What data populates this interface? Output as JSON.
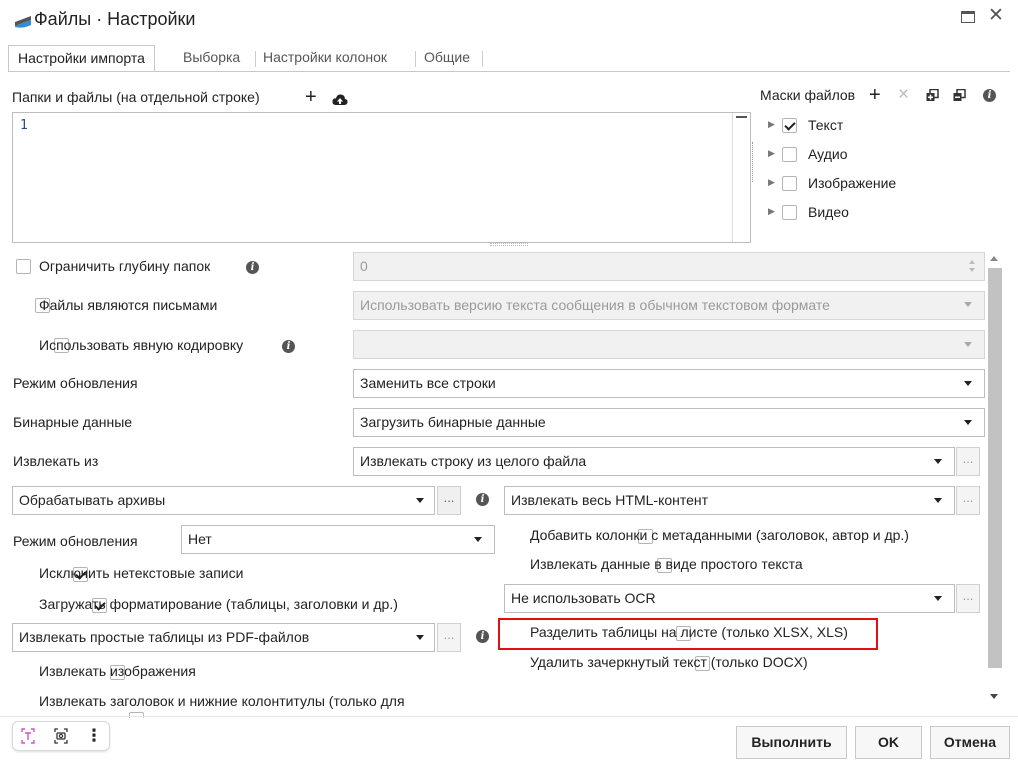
{
  "window": {
    "title": "Файлы · Настройки"
  },
  "tabs": [
    {
      "label": "Настройки импорта",
      "active": true
    },
    {
      "label": "Выборка",
      "active": false
    },
    {
      "label": "Настройки колонок",
      "active": false
    },
    {
      "label": "Общие",
      "active": false
    }
  ],
  "folders": {
    "label": "Папки и файлы (на отдельной строке)",
    "add_symbol": "+",
    "line_numbers": [
      "1"
    ]
  },
  "masks": {
    "label": "Маски файлов",
    "add_symbol": "+",
    "remove_symbol": "×",
    "items": [
      {
        "label": "Текст",
        "checked": true
      },
      {
        "label": "Аудио",
        "checked": false
      },
      {
        "label": "Изображение",
        "checked": false
      },
      {
        "label": "Видео",
        "checked": false
      }
    ]
  },
  "options": {
    "limit_depth": {
      "label": "Ограничить глубину папок",
      "checked": false,
      "value": "0"
    },
    "files_are_letters": {
      "label": "Файлы являются письмами",
      "checked": false,
      "value": "Использовать версию текста сообщения в обычном текстовом формате"
    },
    "explicit_encoding": {
      "label": "Использовать явную кодировку",
      "checked": false,
      "value": ""
    },
    "update_mode": {
      "label": "Режим обновления",
      "value": "Заменить все строки"
    },
    "binary_data": {
      "label": "Бинарные данные",
      "value": "Загрузить бинарные данные"
    },
    "extract_from": {
      "label": "Извлекать из",
      "value": "Извлекать строку из целого файла"
    }
  },
  "left": {
    "archives": {
      "value": "Обрабатывать архивы",
      "ellipsis": "..."
    },
    "update_mode": {
      "label": "Режим обновления",
      "value": "Нет"
    },
    "exclude_nontext": {
      "label": "Исключить нетекстовые записи",
      "checked": true
    },
    "load_formatting": {
      "label": "Загружать форматирование (таблицы, заголовки и др.)",
      "checked": true
    },
    "pdf_tables": {
      "value": "Извлекать простые таблицы из PDF-файлов",
      "ellipsis": "..."
    },
    "extract_images": {
      "label": "Извлекать изображения",
      "checked": false
    },
    "headers_footers": {
      "label": "Извлекать заголовок и нижние колонтитулы (только для",
      "checked": false
    }
  },
  "right": {
    "html": {
      "value": "Извлекать весь HTML-контент",
      "ellipsis": "..."
    },
    "metadata_columns": {
      "label": "Добавить колонки с метаданными (заголовок, автор и др.)",
      "checked": false
    },
    "plain_text": {
      "label": "Извлекать данные в виде простого текста",
      "checked": false
    },
    "ocr": {
      "value": "Не использовать OCR",
      "ellipsis": "..."
    },
    "split_tables": {
      "label": "Разделить таблицы на листе (только XLSX, XLS)",
      "checked": false
    },
    "strikethrough": {
      "label": "Удалить зачеркнутый текст (только DOCX)",
      "checked": false
    }
  },
  "footer": {
    "more_symbol": "⋮",
    "run_label": "Выполнить",
    "ok_label": "OK",
    "cancel_label": "Отмена"
  },
  "colors": {
    "highlight": "#e01010",
    "line_number": "#2b4a8c"
  }
}
